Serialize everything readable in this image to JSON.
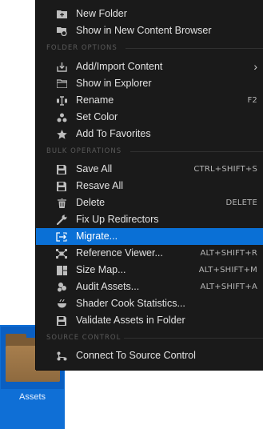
{
  "asset_tile": {
    "label": "Assets"
  },
  "menu": {
    "top_items": [
      {
        "label": "New Folder",
        "icon": "new-folder-icon"
      },
      {
        "label": "Show in New Content Browser",
        "icon": "content-browser-icon"
      }
    ],
    "sections": {
      "folder_options": "FOLDER OPTIONS",
      "bulk_operations": "BULK OPERATIONS",
      "source_control": "SOURCE CONTROL"
    },
    "folder_items": [
      {
        "label": "Add/Import Content",
        "icon": "import-icon",
        "submenu": "›"
      },
      {
        "label": "Show in Explorer",
        "icon": "explorer-icon"
      },
      {
        "label": "Rename",
        "icon": "rename-icon",
        "shortcut": "F2"
      },
      {
        "label": "Set Color",
        "icon": "palette-icon"
      },
      {
        "label": "Add To Favorites",
        "icon": "star-icon"
      }
    ],
    "bulk_items": [
      {
        "label": "Save All",
        "icon": "save-icon",
        "shortcut": "CTRL+SHIFT+S"
      },
      {
        "label": "Resave All",
        "icon": "save-icon"
      },
      {
        "label": "Delete",
        "icon": "trash-icon",
        "shortcut": "DELETE"
      },
      {
        "label": "Fix Up Redirectors",
        "icon": "wrench-icon"
      },
      {
        "label": "Migrate...",
        "icon": "migrate-icon",
        "highlighted": true
      },
      {
        "label": "Reference Viewer...",
        "icon": "reference-viewer-icon",
        "shortcut": "ALT+SHIFT+R"
      },
      {
        "label": "Size Map...",
        "icon": "size-map-icon",
        "shortcut": "ALT+SHIFT+M"
      },
      {
        "label": "Audit Assets...",
        "icon": "audit-icon",
        "shortcut": "ALT+SHIFT+A"
      },
      {
        "label": "Shader Cook Statistics...",
        "icon": "shader-icon"
      },
      {
        "label": "Validate Assets in Folder",
        "icon": "validate-icon"
      }
    ],
    "source_items": [
      {
        "label": "Connect To Source Control",
        "icon": "source-control-icon"
      }
    ]
  },
  "colors": {
    "menu_bg": "#1a1a1a",
    "highlight": "#0a70d6",
    "asset_tile": "#0f6fd6"
  }
}
